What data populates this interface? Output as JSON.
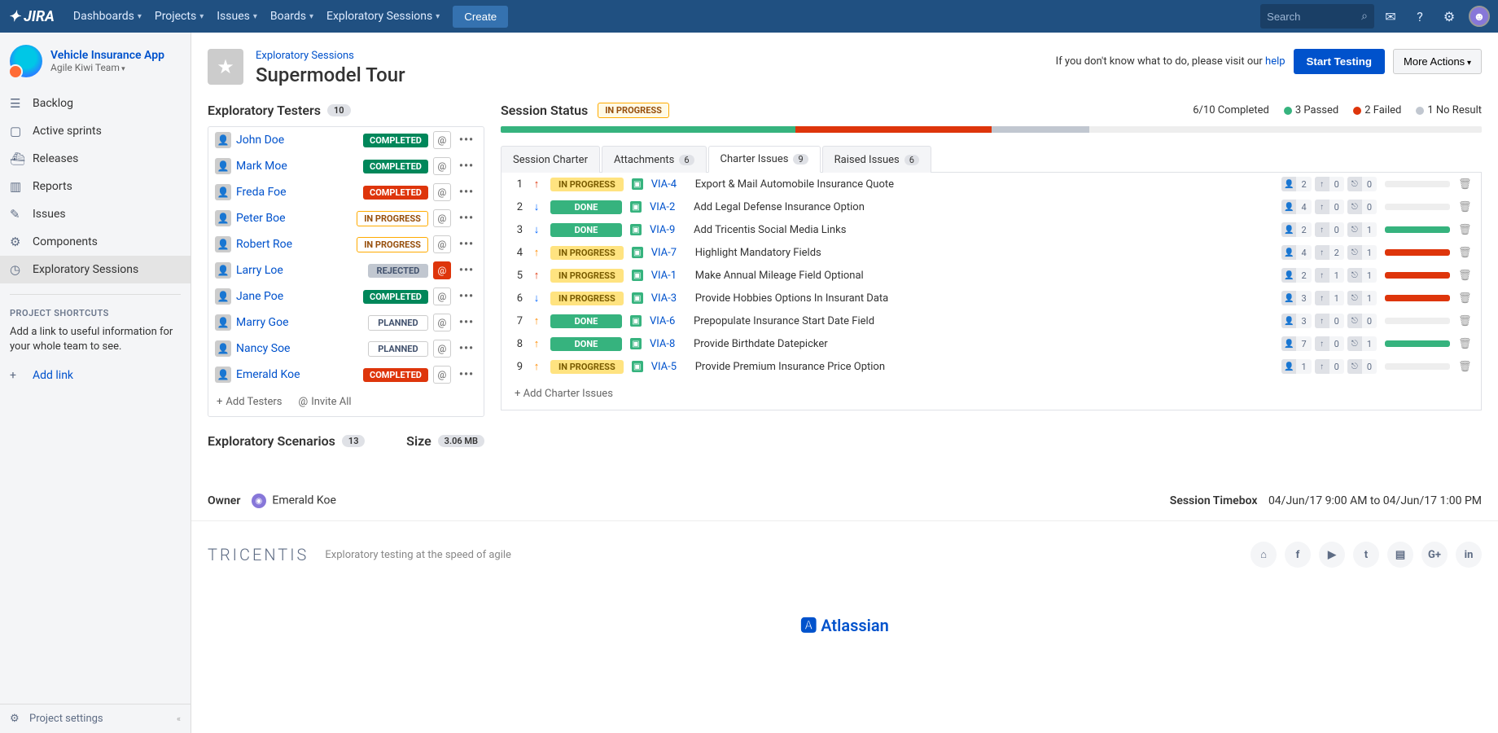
{
  "nav": {
    "items": [
      "Dashboards",
      "Projects",
      "Issues",
      "Boards",
      "Exploratory Sessions"
    ],
    "create": "Create",
    "search_placeholder": "Search"
  },
  "project": {
    "name": "Vehicle Insurance App",
    "team": "Agile Kiwi Team"
  },
  "sidebar": {
    "items": [
      {
        "label": "Backlog",
        "icon": "☰"
      },
      {
        "label": "Active sprints",
        "icon": "▢"
      },
      {
        "label": "Releases",
        "icon": "⛴"
      },
      {
        "label": "Reports",
        "icon": "▥"
      },
      {
        "label": "Issues",
        "icon": "✎"
      },
      {
        "label": "Components",
        "icon": "⚙"
      },
      {
        "label": "Exploratory Sessions",
        "icon": "◷",
        "active": true
      }
    ],
    "shortcuts_header": "PROJECT SHORTCUTS",
    "shortcuts_text": "Add a link to useful information for your whole team to see.",
    "add_link": "Add link",
    "settings": "Project settings"
  },
  "page": {
    "breadcrumb": "Exploratory Sessions",
    "title": "Supermodel Tour",
    "help_text": "If you don't know what to do, please visit our ",
    "help_link": "help",
    "start": "Start Testing",
    "more": "More Actions"
  },
  "testers": {
    "header": "Exploratory Testers",
    "count": "10",
    "list": [
      {
        "name": "John Doe",
        "status": "COMPLETED",
        "cls": "st-completed-g",
        "at": ""
      },
      {
        "name": "Mark Moe",
        "status": "COMPLETED",
        "cls": "st-completed-g",
        "at": ""
      },
      {
        "name": "Freda Foe",
        "status": "COMPLETED",
        "cls": "st-completed-r",
        "at": ""
      },
      {
        "name": "Peter Boe",
        "status": "IN PROGRESS",
        "cls": "st-inprogress",
        "at": ""
      },
      {
        "name": "Robert Roe",
        "status": "IN PROGRESS",
        "cls": "st-inprogress",
        "at": ""
      },
      {
        "name": "Larry Loe",
        "status": "REJECTED",
        "cls": "st-rejected",
        "at": "red"
      },
      {
        "name": "Jane Poe",
        "status": "COMPLETED",
        "cls": "st-completed-g",
        "at": ""
      },
      {
        "name": "Marry Goe",
        "status": "PLANNED",
        "cls": "st-planned",
        "at": ""
      },
      {
        "name": "Nancy Soe",
        "status": "PLANNED",
        "cls": "st-planned",
        "at": ""
      },
      {
        "name": "Emerald Koe",
        "status": "COMPLETED",
        "cls": "st-completed-r",
        "at": ""
      }
    ],
    "add": "Add Testers",
    "invite": "Invite All"
  },
  "scenarios": {
    "header": "Exploratory Scenarios",
    "count": "13",
    "size_label": "Size",
    "size": "3.06 MB"
  },
  "session": {
    "header": "Session Status",
    "status": "IN PROGRESS",
    "completed": "6/10 Completed",
    "passed": "3 Passed",
    "failed": "2 Failed",
    "noresult": "1 No Result",
    "progress": [
      {
        "color": "#36b37e",
        "width": "30%"
      },
      {
        "color": "#de350b",
        "width": "20%"
      },
      {
        "color": "#c1c7d0",
        "width": "10%"
      },
      {
        "color": "#eee",
        "width": "40%"
      }
    ]
  },
  "tabs": [
    {
      "label": "Session Charter"
    },
    {
      "label": "Attachments",
      "count": "6"
    },
    {
      "label": "Charter Issues",
      "count": "9",
      "active": true
    },
    {
      "label": "Raised Issues",
      "count": "6"
    }
  ],
  "issues": [
    {
      "n": "1",
      "prio": "↑",
      "pcls": "up-r",
      "status": "IN PROGRESS",
      "scls": "is-inprogress",
      "key": "VIA-4",
      "title": "Export & Mail Automobile Insurance Quote",
      "c1": "2",
      "c2": "0",
      "c3": "0",
      "bar": "#eee",
      "bw": "0%"
    },
    {
      "n": "2",
      "prio": "↓",
      "pcls": "dn",
      "status": "DONE",
      "scls": "is-done",
      "key": "VIA-2",
      "title": "Add Legal Defense Insurance Option",
      "c1": "4",
      "c2": "0",
      "c3": "0",
      "bar": "#eee",
      "bw": "0%"
    },
    {
      "n": "3",
      "prio": "↓",
      "pcls": "dn",
      "status": "DONE",
      "scls": "is-done",
      "key": "VIA-9",
      "title": "Add Tricentis Social Media Links",
      "c1": "2",
      "c2": "0",
      "c3": "1",
      "bar": "#36b37e",
      "bw": "100%"
    },
    {
      "n": "4",
      "prio": "↑",
      "pcls": "up-o",
      "status": "IN PROGRESS",
      "scls": "is-inprogress",
      "key": "VIA-7",
      "title": "Highlight Mandatory Fields",
      "c1": "4",
      "c2": "2",
      "c3": "1",
      "bar": "#de350b",
      "bw": "100%"
    },
    {
      "n": "5",
      "prio": "↑",
      "pcls": "up-r",
      "status": "IN PROGRESS",
      "scls": "is-inprogress",
      "key": "VIA-1",
      "title": "Make Annual Mileage Field Optional",
      "c1": "2",
      "c2": "1",
      "c3": "1",
      "bar": "#de350b",
      "bw": "100%"
    },
    {
      "n": "6",
      "prio": "↓",
      "pcls": "dn",
      "status": "IN PROGRESS",
      "scls": "is-inprogress",
      "key": "VIA-3",
      "title": "Provide Hobbies Options In Insurant Data",
      "c1": "3",
      "c2": "1",
      "c3": "1",
      "bar": "#de350b",
      "bw": "100%"
    },
    {
      "n": "7",
      "prio": "↑",
      "pcls": "up-o",
      "status": "DONE",
      "scls": "is-done",
      "key": "VIA-6",
      "title": "Prepopulate Insurance Start Date Field",
      "c1": "3",
      "c2": "0",
      "c3": "0",
      "bar": "#eee",
      "bw": "0%"
    },
    {
      "n": "8",
      "prio": "↑",
      "pcls": "up-o",
      "status": "DONE",
      "scls": "is-done",
      "key": "VIA-8",
      "title": "Provide Birthdate Datepicker",
      "c1": "7",
      "c2": "0",
      "c3": "1",
      "bar": "#36b37e",
      "bw": "100%"
    },
    {
      "n": "9",
      "prio": "↑",
      "pcls": "up-o",
      "status": "IN PROGRESS",
      "scls": "is-inprogress",
      "key": "VIA-5",
      "title": "Provide Premium Insurance Price Option",
      "c1": "1",
      "c2": "0",
      "c3": "0",
      "bar": "#eee",
      "bw": "0%"
    }
  ],
  "add_charter": "Add Charter Issues",
  "owner": {
    "label": "Owner",
    "name": "Emerald Koe"
  },
  "timebox": {
    "label": "Session Timebox",
    "value": "04/Jun/17 9:00 AM to 04/Jun/17 1:00 PM"
  },
  "footer": {
    "brand": "TRICENTIS",
    "tag": "Exploratory testing at the speed of agile",
    "atlassian": "Atlassian"
  }
}
